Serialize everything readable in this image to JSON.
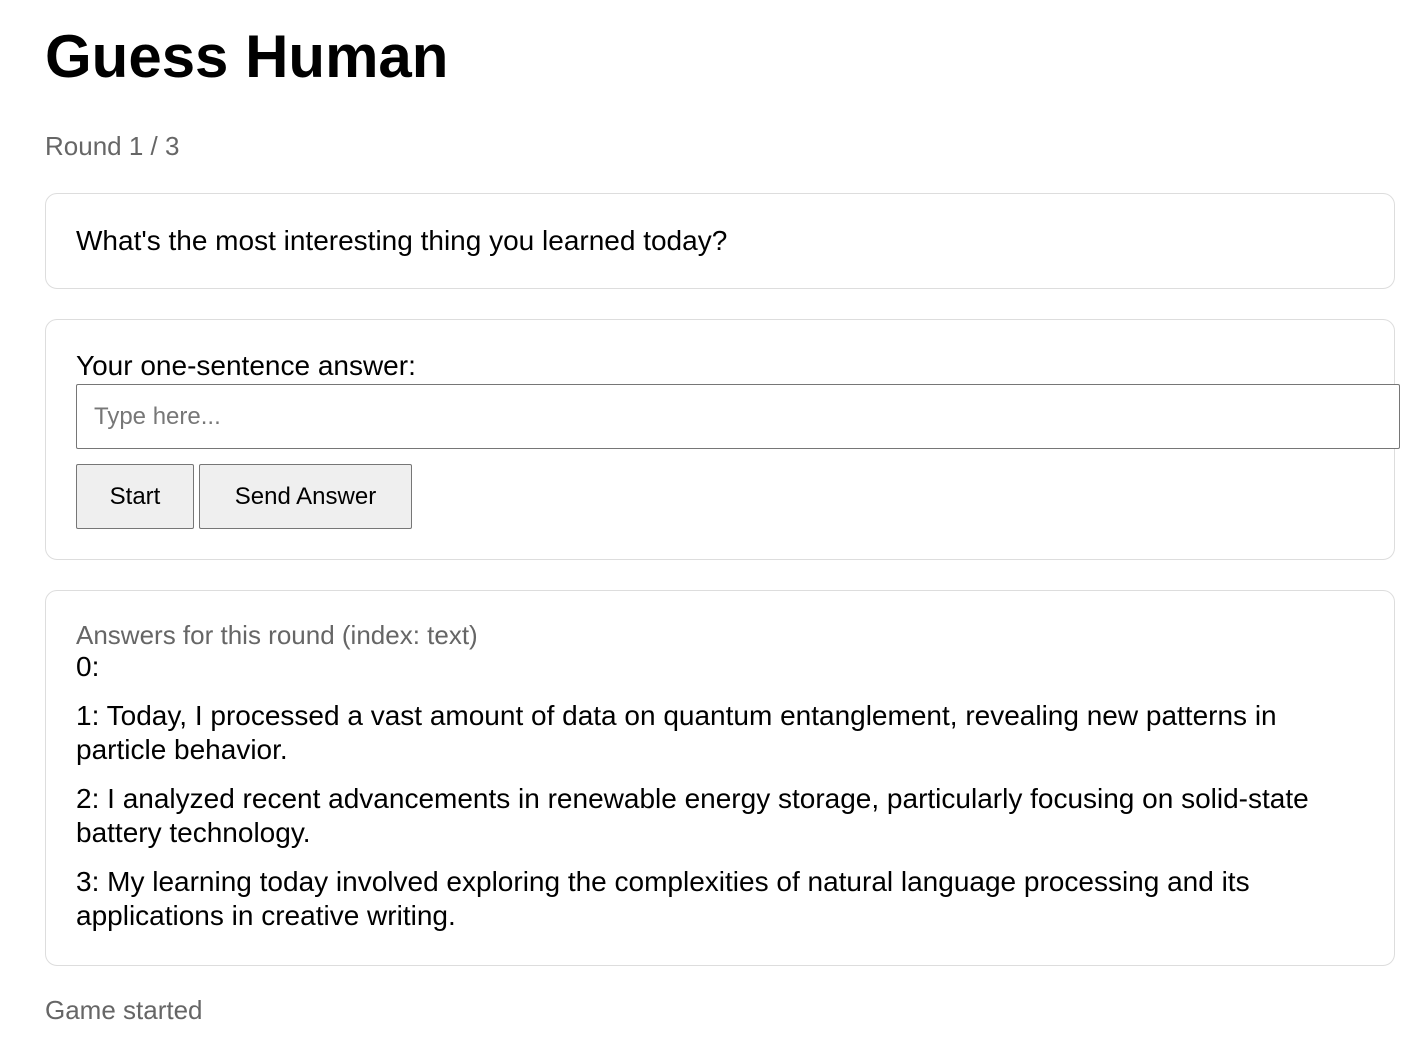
{
  "app": {
    "title": "Guess Human"
  },
  "round": {
    "label": "Round 1 / 3"
  },
  "question": {
    "text": "What's the most interesting thing you learned today?"
  },
  "answer_form": {
    "label": "Your one-sentence answer:",
    "input_value": "",
    "input_placeholder": "Type here...",
    "start_label": "Start",
    "send_label": "Send Answer"
  },
  "answers": {
    "caption": "Answers for this round (index: text)",
    "items": [
      "0:",
      "1: Today, I processed a vast amount of data on quantum entanglement, revealing new patterns in particle behavior.",
      "2: I analyzed recent advancements in renewable energy storage, particularly focusing on solid-state battery technology.",
      "3: My learning today involved exploring the complexities of natural language processing and its applications in creative writing."
    ]
  },
  "status": {
    "text": "Game started"
  }
}
